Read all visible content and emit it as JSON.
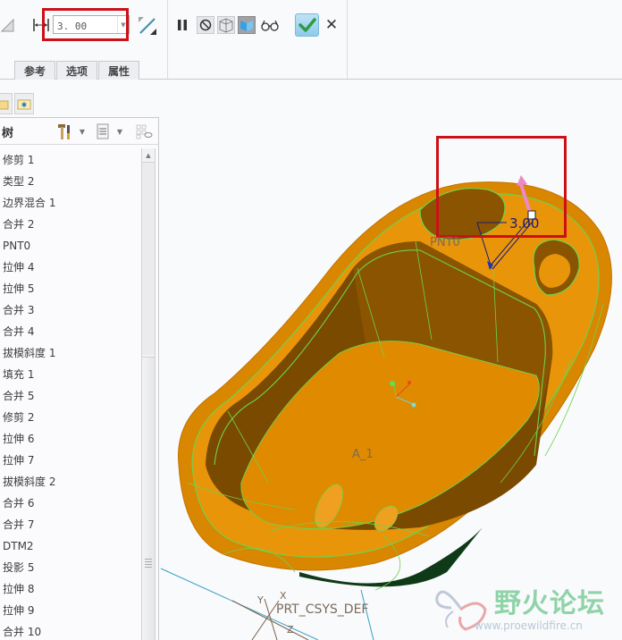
{
  "ribbon": {
    "dimension": {
      "value": "3. 00",
      "tooltip_icon": "thickness-dimension-icon"
    },
    "tabs": [
      {
        "label": "参考"
      },
      {
        "label": "选项"
      },
      {
        "label": "属性"
      }
    ],
    "controls": {
      "pause": "pause-icon",
      "no_preview": "no-preview-icon",
      "preview_wireframe": "preview-geometry-icon",
      "verify": "verify-mode-icon",
      "glasses": "glasses-icon"
    },
    "ok_color": "#33a852",
    "cancel_label": "✕"
  },
  "tree": {
    "title": "树",
    "items": [
      {
        "label": "修剪 1"
      },
      {
        "label": "类型 2"
      },
      {
        "label": "边界混合 1"
      },
      {
        "label": "合并 2"
      },
      {
        "label": "PNT0"
      },
      {
        "label": "拉伸 4"
      },
      {
        "label": "拉伸 5"
      },
      {
        "label": "合并 3"
      },
      {
        "label": "合并 4"
      },
      {
        "label": "拔模斜度 1"
      },
      {
        "label": "填充 1"
      },
      {
        "label": "合并 5"
      },
      {
        "label": "修剪 2"
      },
      {
        "label": "拉伸 6"
      },
      {
        "label": "拉伸 7"
      },
      {
        "label": "拔模斜度 2"
      },
      {
        "label": "合并 6"
      },
      {
        "label": "合并 7"
      },
      {
        "label": "DTM2"
      },
      {
        "label": "投影 5"
      },
      {
        "label": "拉伸 8"
      },
      {
        "label": "拉伸 9"
      },
      {
        "label": "合并 10"
      }
    ]
  },
  "viewport": {
    "dimension_label": "3.00",
    "point_label": "PNT0",
    "axis_label": "A_1",
    "csys_label": "PRT_CSYS_DEF",
    "csys_axes": {
      "x": "X",
      "y": "Y",
      "z": "Z"
    },
    "model_color": "#e08a00",
    "edge_color": "#6fd24a",
    "highlight_color": "#cc1018"
  },
  "watermark": {
    "name": "野火论坛",
    "url": "www.proewildfire.cn"
  }
}
